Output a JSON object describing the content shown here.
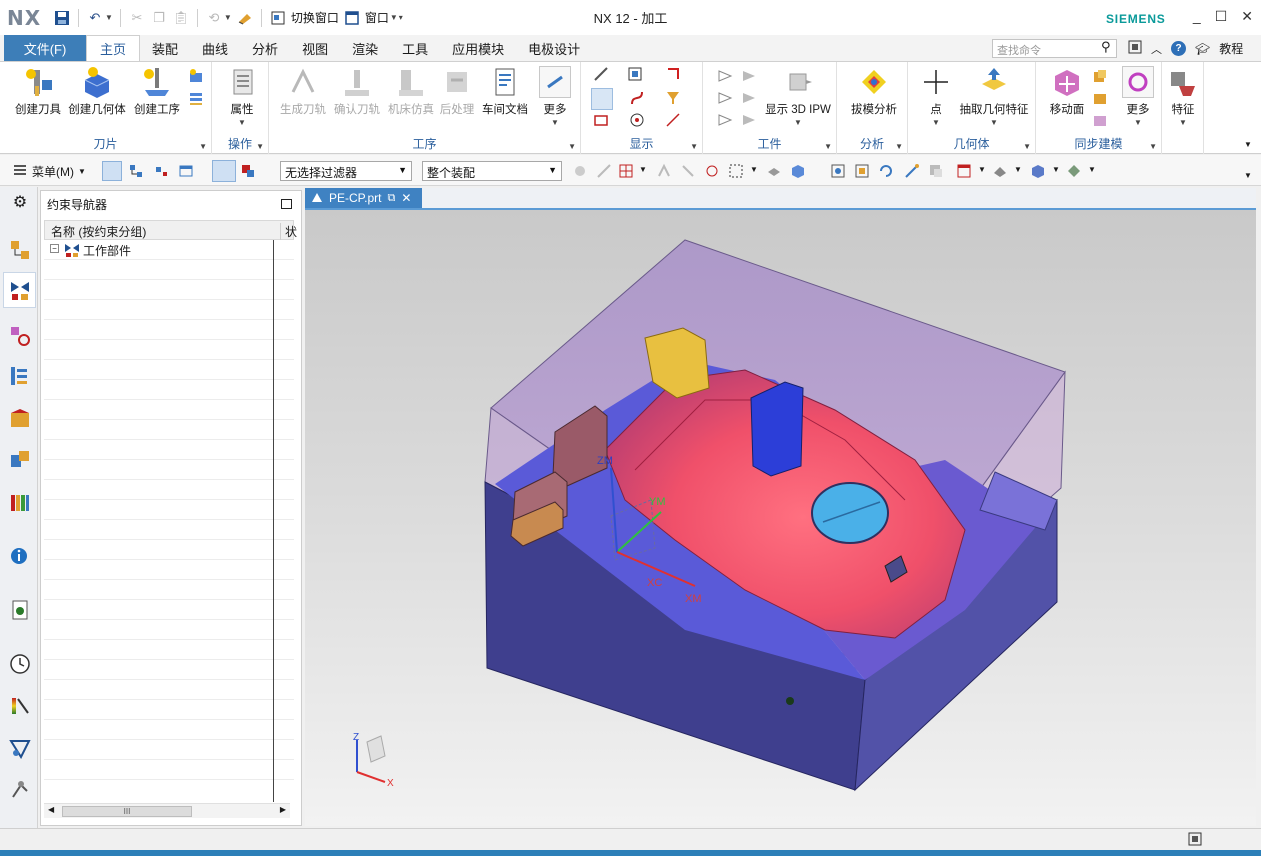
{
  "app": {
    "logo": "NX",
    "window_title": "NX 12 - 加工",
    "brand": "SIEMENS"
  },
  "quick_access": {
    "switch_window_label": "切换窗口",
    "window_label": "窗口"
  },
  "tabs": {
    "file": "文件(F)",
    "items": [
      "主页",
      "装配",
      "曲线",
      "分析",
      "视图",
      "渲染",
      "工具",
      "应用模块",
      "电极设计"
    ],
    "active_index": 0,
    "search_placeholder": "查找命令",
    "tutorial_label": "教程"
  },
  "ribbon": {
    "groups": [
      {
        "label": "刀片",
        "buttons": [
          "创建刀具",
          "创建几何体",
          "创建工序"
        ]
      },
      {
        "label": "操作",
        "buttons": [
          "属性"
        ]
      },
      {
        "label": "工序",
        "buttons": [
          "生成刀轨",
          "确认刀轨",
          "机床仿真",
          "后处理",
          "车间文档",
          "更多"
        ]
      },
      {
        "label": "显示",
        "buttons": []
      },
      {
        "label": "工件",
        "buttons": [
          "显示 3D IPW"
        ]
      },
      {
        "label": "分析",
        "buttons": [
          "拔模分析"
        ]
      },
      {
        "label": "几何体",
        "buttons": [
          "点",
          "抽取几何特征"
        ]
      },
      {
        "label": "同步建模",
        "buttons": [
          "移动面",
          "更多"
        ]
      },
      {
        "label": "",
        "buttons": [
          "特征"
        ]
      }
    ]
  },
  "toolbar": {
    "menu_label": "菜单(M)",
    "filter_value": "无选择过滤器",
    "scope_value": "整个装配"
  },
  "navigator": {
    "title": "约束导航器",
    "col_name": "名称 (按约束分组)",
    "col_status": "状",
    "root_item": "工作部件",
    "scroll_thumb": "III"
  },
  "document": {
    "tab_label": "PE-CP.prt"
  },
  "viewport": {
    "labels": {
      "zm": "ZM",
      "ym": "YM",
      "xc": "XC",
      "xm": "XM",
      "triad_z": "Z",
      "triad_x": "X"
    }
  }
}
